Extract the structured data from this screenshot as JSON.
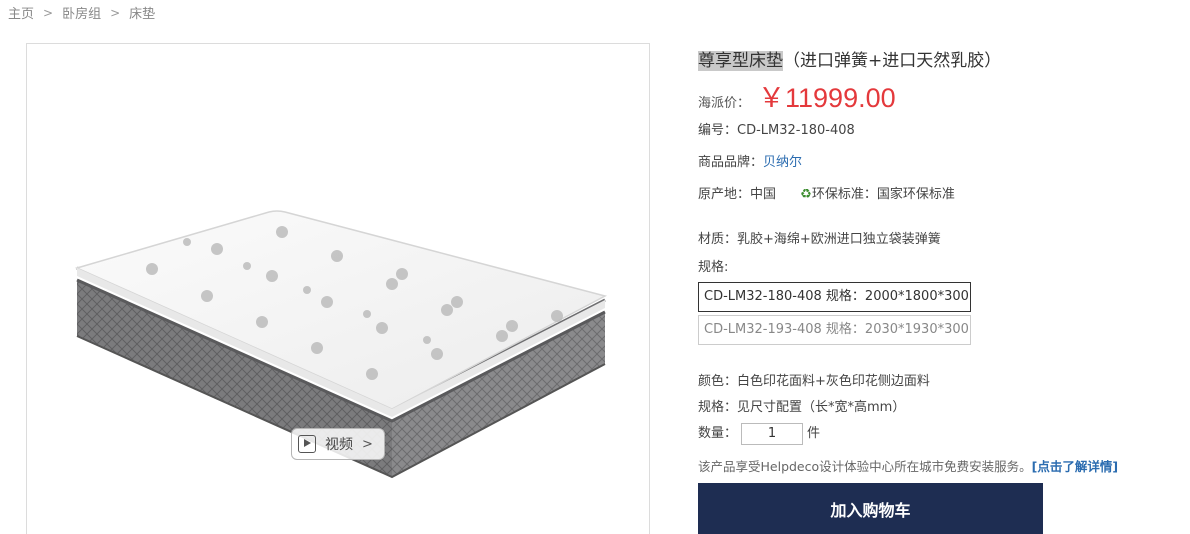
{
  "breadcrumb": {
    "items": [
      "主页",
      "卧房组",
      "床垫"
    ],
    "separator": ">"
  },
  "product": {
    "title_highlight": "尊享型床垫",
    "title_rest": "（进口弹簧+进口天然乳胶）",
    "price_label": "海派价：",
    "price_value": "￥11999.00",
    "code": "编号：CD-LM32-180-408",
    "brand_label": "商品品牌：",
    "brand_value": "贝纳尔",
    "origin": "原产地：中国",
    "eco_icon": "♻",
    "eco_standard": "环保标准：国家环保标准",
    "material": "材质：乳胶+海绵+欧洲进口独立袋装弹簧",
    "spec_label": "规格:",
    "spec_options": [
      "CD-LM32-180-408 规格：2000*1800*300",
      "CD-LM32-193-408 规格：2030*1930*300"
    ],
    "selected_spec_index": 0,
    "color": "颜色：白色印花面料+灰色印花侧边面料",
    "size_note": "规格：见尺寸配置（长*宽*高mm）",
    "qty_label": "数量：",
    "qty_value": "1",
    "qty_unit": "件",
    "service_text": "该产品享受Helpdeco设计体验中心所在城市免费安装服务。",
    "service_link": "[点击了解详情]",
    "add_to_cart": "加入购物车"
  },
  "media": {
    "video_label": "视频",
    "video_icon": "play-icon"
  },
  "colors": {
    "price": "#e4393c",
    "cart_button": "#1e2d52",
    "link": "#2b6cb0"
  }
}
